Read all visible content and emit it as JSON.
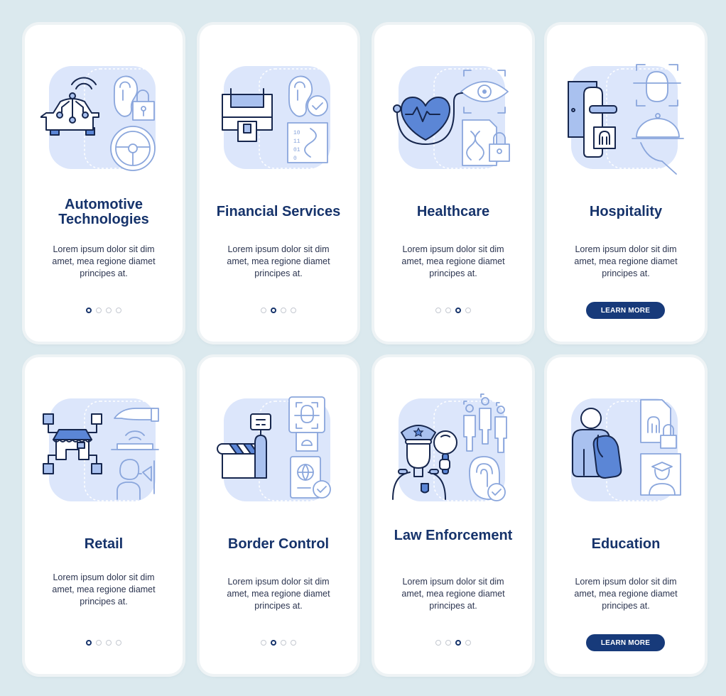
{
  "colors": {
    "background": "#dbe9ee",
    "card": "#ffffff",
    "title": "#16336b",
    "accent": "#173a7a",
    "illustration_bg": "#dce6fb",
    "dot_inactive": "#c4c8d0"
  },
  "cards": [
    {
      "title_lines": [
        "Automotive",
        "Technologies"
      ],
      "description_lines": [
        "Lorem ipsum dolor sit dim",
        "amet, mea regione diamet",
        "principes at."
      ],
      "pagination": {
        "total": 4,
        "active": 1
      },
      "icons": [
        "connected-car-icon",
        "ear-biometric-icon",
        "padlock-icon",
        "steering-wheel-icon"
      ]
    },
    {
      "title_lines": [
        "Financial Services"
      ],
      "description_lines": [
        "Lorem ipsum dolor sit dim",
        "amet, mea regione diamet",
        "principes at."
      ],
      "pagination": {
        "total": 4,
        "active": 2
      },
      "icons": [
        "atm-icon",
        "ear-biometric-icon",
        "checkmark-icon",
        "dna-code-icon"
      ]
    },
    {
      "title_lines": [
        "Healthcare"
      ],
      "description_lines": [
        "Lorem ipsum dolor sit dim",
        "amet, mea regione diamet",
        "principes at."
      ],
      "pagination": {
        "total": 4,
        "active": 3
      },
      "icons": [
        "stethoscope-heart-icon",
        "eye-scan-icon",
        "dna-document-icon",
        "padlock-icon"
      ]
    },
    {
      "title_lines": [
        "Hospitality"
      ],
      "description_lines": [
        "Lorem ipsum dolor sit dim",
        "amet, mea regione diamet",
        "principes at."
      ],
      "button_label": "LEARN MORE",
      "icons": [
        "door-fingerprint-lock-icon",
        "face-scan-icon",
        "cloche-serving-icon"
      ]
    },
    {
      "title_lines": [
        "Retail"
      ],
      "description_lines": [
        "Lorem ipsum dolor sit dim",
        "amet, mea regione diamet",
        "principes at."
      ],
      "pagination": {
        "total": 4,
        "active": 1
      },
      "icons": [
        "store-network-icon",
        "contactless-hand-icon",
        "customer-camera-icon"
      ]
    },
    {
      "title_lines": [
        "Border Control"
      ],
      "description_lines": [
        "Lorem ipsum dolor sit dim",
        "amet, mea regione diamet",
        "principes at."
      ],
      "pagination": {
        "total": 4,
        "active": 2
      },
      "icons": [
        "border-barrier-icon",
        "face-scan-kiosk-icon",
        "passport-check-icon"
      ]
    },
    {
      "title_lines": [
        "Law Enforcement"
      ],
      "description_lines": [
        "Lorem ipsum dolor sit dim",
        "amet, mea regione diamet",
        "principes at."
      ],
      "pagination": {
        "total": 4,
        "active": 3
      },
      "icons": [
        "police-officer-icon",
        "magnifier-icon",
        "crowd-scan-icon",
        "fingerprint-check-icon"
      ]
    },
    {
      "title_lines": [
        "Education"
      ],
      "description_lines": [
        "Lorem ipsum dolor sit dim",
        "amet, mea regione diamet",
        "principes at."
      ],
      "button_label": "LEARN MORE",
      "icons": [
        "student-backpack-icon",
        "fingerprint-document-icon",
        "graduate-scan-icon"
      ]
    }
  ]
}
